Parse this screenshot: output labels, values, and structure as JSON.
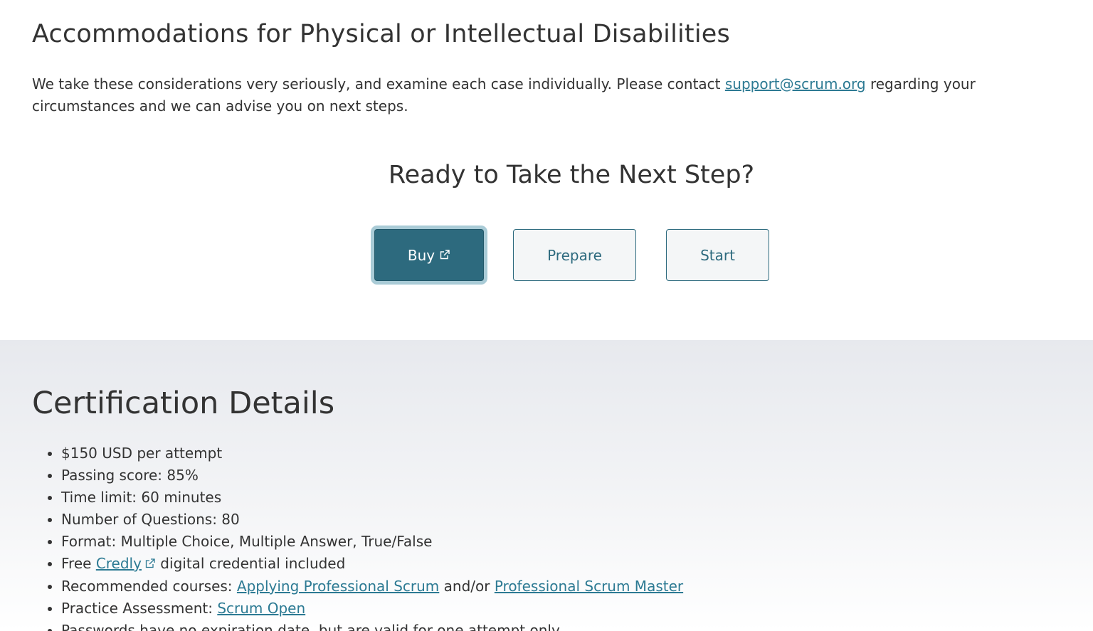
{
  "accommodations": {
    "heading": "Accommodations for Physical or Intellectual Disabilities",
    "paragraph_before": "We take these considerations very seriously, and examine each case individually. Please contact ",
    "email_link": "support@scrum.org",
    "paragraph_after": " regarding your circumstances and we can advise you on next steps."
  },
  "cta": {
    "heading": "Ready to Take the Next Step?",
    "buy_label": "Buy",
    "prepare_label": "Prepare",
    "start_label": "Start"
  },
  "certification": {
    "heading": "Certification Details",
    "price": "$150 USD per attempt",
    "passing_score": "Passing score: 85%",
    "time_limit": "Time limit: 60 minutes",
    "questions": "Number of Questions: 80",
    "format": "Format: Multiple Choice, Multiple Answer, True/False",
    "credly_prefix": "Free ",
    "credly_link": "Credly",
    "credly_suffix": " digital credential included",
    "courses_prefix": "Recommended courses: ",
    "course_1": "Applying Professional Scrum",
    "courses_middle": " and/or ",
    "course_2": "Professional Scrum Master",
    "practice_prefix": "Practice Assessment: ",
    "practice_link": "Scrum Open",
    "passwords": "Passwords have no expiration date, but are valid for one attempt only."
  },
  "colors": {
    "brand_teal": "#2d6a7e",
    "link": "#2c7a93",
    "text": "#333333"
  },
  "icons": {
    "external_link": "external-link-icon"
  }
}
